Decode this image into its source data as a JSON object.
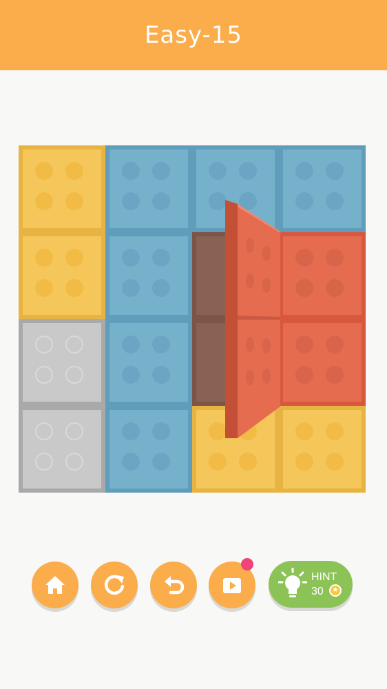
{
  "header": {
    "title": "Easy-15",
    "background": "#fbac4b"
  },
  "board": {
    "rows": 4,
    "cols": 4,
    "tiles": [
      [
        "yellow",
        "blue",
        "blue",
        "blue"
      ],
      [
        "yellow",
        "blue",
        "brown",
        "red"
      ],
      [
        "gray",
        "blue",
        "brown",
        "red"
      ],
      [
        "gray",
        "blue",
        "yellow",
        "yellow"
      ]
    ],
    "folding_piece": {
      "color": "red",
      "state": "mid-fold"
    }
  },
  "toolbar": {
    "home_icon": "home-icon",
    "restart_icon": "restart-icon",
    "undo_icon": "undo-icon",
    "video_icon": "video-play-icon",
    "hint": {
      "label": "HINT",
      "count": "30",
      "icon": "lightbulb-icon",
      "coin_icon": "coin-star-icon"
    }
  },
  "colors": {
    "yellow": "#f5c65a",
    "blue": "#76b1cc",
    "gray": "#c9c9c9",
    "red": "#e66c50",
    "brown": "#8a6254",
    "button": "#fbac4b",
    "hint_button": "#8cc356",
    "notification": "#f0437a"
  }
}
